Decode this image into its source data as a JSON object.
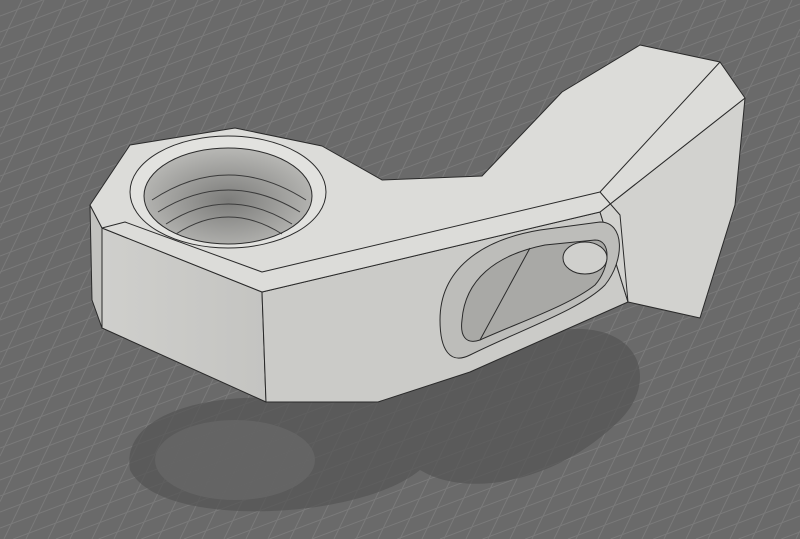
{
  "viewport": {
    "background_color": "#6a6a6a",
    "grid_color": "#7a7a7a",
    "part_top_color": "#d9d9d6",
    "part_side_color": "#c9c9c6",
    "edge_color": "#2a2a2a"
  }
}
